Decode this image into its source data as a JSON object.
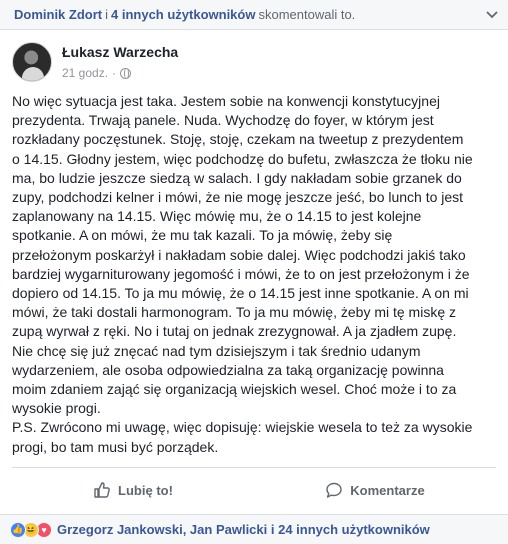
{
  "topbar": {
    "commenter": "Dominik Zdort",
    "separator": "i",
    "others": "4 innych użytkowników",
    "suffix": "skomentowali to.",
    "chevron_icon": "chevron-down-icon"
  },
  "post": {
    "author": "Łukasz Warzecha",
    "time": "21 godz.",
    "dot": "·",
    "privacy_icon": "globe-icon",
    "text": "No więc sytuacja jest taka. Jestem sobie na konwencji konstytucyjnej\nprezydenta. Trwają panele. Nuda. Wychodzę do foyer, w którym jest\nrozkładany poczęstunek. Stoję, stoję, czekam na tweetup z prezydentem\no 14.15. Głodny jestem, więc podchodzę do bufetu, zwłaszcza że tłoku nie\nma, bo ludzie jeszcze siedzą w salach. I gdy nakładam sobie grzanek do\nzupy, podchodzi kelner i mówi, że nie mogę jeszcze jeść, bo lunch to jest\nzaplanowany na 14.15. Więc mówię mu, że o 14.15 to jest kolejne\nspotkanie. A on mówi, że mu tak kazali. To ja mówię, żeby się\nprzełożonym poskarżył i nakładam sobie dalej. Więc podchodzi jakiś tako\nbardziej wygarniturowany jegomość i mówi, że to on jest przełożonym i że\ndopiero od 14.15. To ja mu mówię, że o 14.15 jest inne spotkanie. A on mi\nmówi, że taki dostali harmonogram. To ja mu mówię, żeby mi tę miskę z\nzupą wyrwał z ręki. No i tutaj on jednak zrezygnował. A ja zjadłem zupę.\nNie chcę się już znęcać nad tym dzisiejszym i tak średnio udanym\nwydarzeniem, ale osoba odpowiedzialna za taką organizację powinna\nmoim zdaniem zająć się organizacją wiejskich wesel. Choć może i to za\nwysokie progi.\nP.S. Zwrócono mi uwagę, więc dopisuję: wiejskie wesela to też za wysokie\nprogi, bo tam musi być porządek."
  },
  "actions": {
    "like_label": "Lubię to!",
    "comment_label": "Komentarze"
  },
  "reactions": {
    "types": [
      "like",
      "haha",
      "love"
    ],
    "names": "Grzegorz Jankowski, Jan Pawlicki i 24 innych użytkowników"
  },
  "colors": {
    "link": "#385898",
    "muted": "#90949c",
    "like": "#4080ff",
    "love": "#f25268",
    "haha": "#f7c945"
  }
}
